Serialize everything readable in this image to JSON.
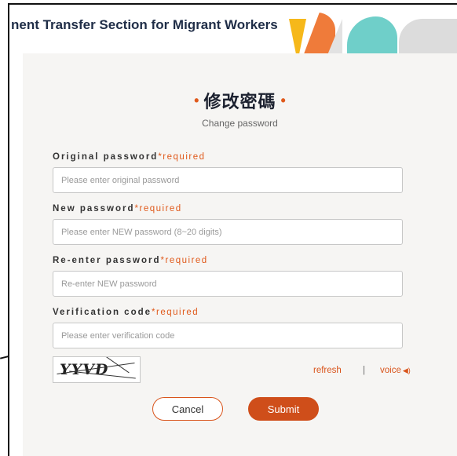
{
  "header": {
    "title": "nent Transfer Section for Migrant Workers"
  },
  "form": {
    "title_zh": "修改密碼",
    "title_dot": "•",
    "subtitle": "Change password",
    "required_marker": "*required",
    "fields": [
      {
        "label": "Original password",
        "placeholder": "Please enter original password",
        "value": ""
      },
      {
        "label": "New password",
        "placeholder": "Please enter NEW password (8~20 digits)",
        "value": ""
      },
      {
        "label": "Re-enter password",
        "placeholder": "Re-enter NEW password",
        "value": ""
      },
      {
        "label": "Verification code",
        "placeholder": "Please enter verification code",
        "value": ""
      }
    ],
    "captcha_text": "YYVD",
    "refresh_label": "refresh",
    "separator": "|",
    "voice_label": "voice",
    "voice_icon": "speaker-icon",
    "cancel_label": "Cancel",
    "submit_label": "Submit"
  },
  "colors": {
    "accent": "#d9541b",
    "submit_bg": "#cf4e1a",
    "panel_bg": "#f6f5f3",
    "title_text": "#1f2d47"
  }
}
